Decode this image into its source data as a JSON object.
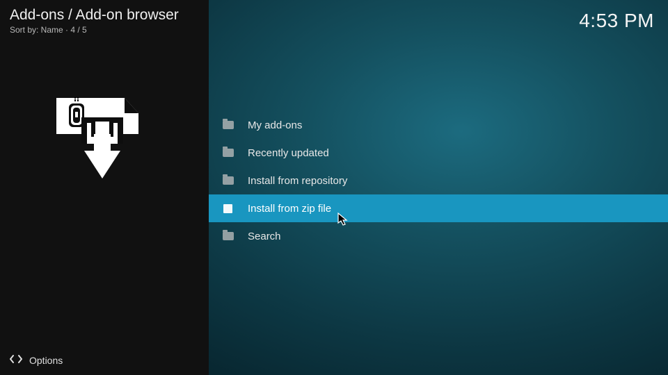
{
  "breadcrumb": "Add-ons / Add-on browser",
  "sort_line": "Sort by: Name  ·  4 / 5",
  "clock": "4:53 PM",
  "footer": {
    "options_label": "Options"
  },
  "menu": {
    "items": [
      {
        "label": "My add-ons"
      },
      {
        "label": "Recently updated"
      },
      {
        "label": "Install from repository"
      },
      {
        "label": "Install from zip file"
      },
      {
        "label": "Search"
      }
    ],
    "selected_index": 3
  }
}
